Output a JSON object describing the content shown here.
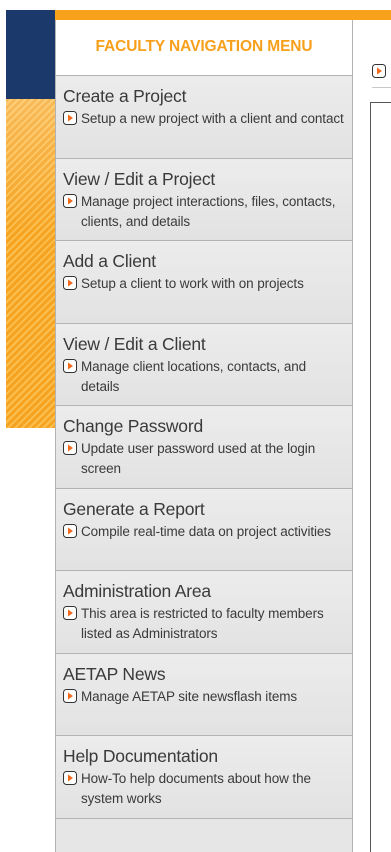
{
  "menu": {
    "title": "FACULTY NAVIGATION MENU",
    "items": [
      {
        "title": "Create a Project",
        "description": "Setup a new project with a client and contact"
      },
      {
        "title": "View / Edit a Project",
        "description": "Manage project interactions, files, contacts, clients, and details"
      },
      {
        "title": "Add a Client",
        "description": "Setup a client to work with on projects"
      },
      {
        "title": "View / Edit a Client",
        "description": "Manage client locations, contacts, and details"
      },
      {
        "title": "Change Password",
        "description": "Update user password used at the login screen"
      },
      {
        "title": "Generate a Report",
        "description": "Compile real-time data on project activities"
      },
      {
        "title": "Administration Area",
        "description": "This area is restricted to faculty members listed as Administrators"
      },
      {
        "title": "AETAP News",
        "description": "Manage AETAP site newsflash items"
      },
      {
        "title": "Help Documentation",
        "description": "How-To help documents about how the system works"
      }
    ]
  },
  "icons": {
    "bullet": "arrow-circle-right-icon"
  },
  "colors": {
    "accent_orange": "#f7a01c",
    "navy": "#1b3a6b",
    "menu_background": "#e6e6e6",
    "text": "#3a3a3a"
  }
}
